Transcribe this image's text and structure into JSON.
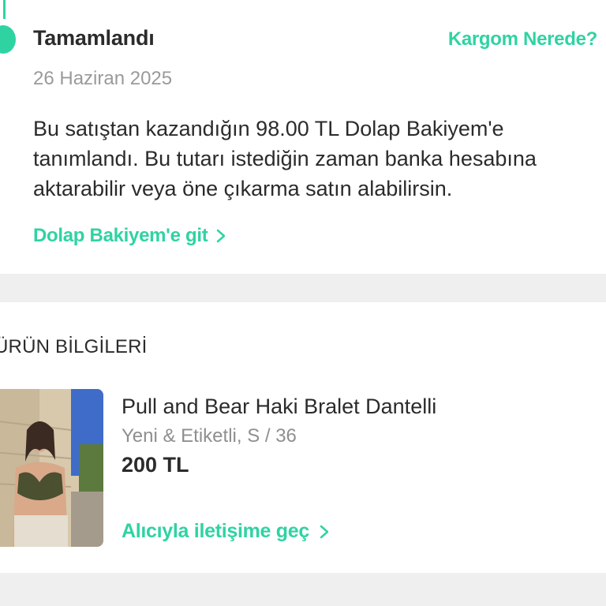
{
  "order_status": {
    "title": "Tamamlandı",
    "date": "26 Haziran 2025",
    "track_link": "Kargom Nerede?",
    "message": "Bu satıştan kazandığın 98.00 TL Dolap Bakiyem'e\ntanımlandı. Bu tutarı istediğin zaman banka hesabına\naktarabilir veya öne çıkarma satın alabilirsin.",
    "balance_link": "Dolap Bakiyem'e git",
    "accent_color": "#2fd3a2"
  },
  "product_info": {
    "section_title": "ÜRÜN BİLGİLERİ",
    "name": "Pull and Bear Haki Bralet Dantelli",
    "meta": "Yeni & Etiketli, S / 36",
    "price": "200 TL",
    "contact_link": "Alıcıyla iletişime geç"
  },
  "icons": {
    "chevron": "chevron-right-icon"
  }
}
